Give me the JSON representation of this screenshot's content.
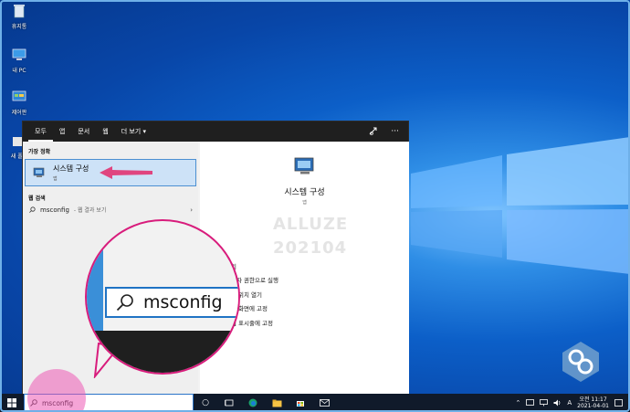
{
  "desktop": {
    "icons": [
      {
        "label": "휴지통",
        "name": "recycle-bin-icon"
      },
      {
        "label": "내 PC",
        "name": "this-pc-icon"
      },
      {
        "label": "제어판",
        "name": "control-panel-icon"
      },
      {
        "label": "새 폴더",
        "name": "new-folder-icon"
      }
    ]
  },
  "start": {
    "tabs": [
      "모두",
      "앱",
      "문서",
      "웹",
      "더 보기"
    ],
    "best_match_heading": "가장 정확",
    "best_match": {
      "title": "시스템 구성",
      "subtitle": "앱"
    },
    "web_heading": "웹 검색",
    "web_result": {
      "query": "msconfig",
      "hint": "- 웹 결과 보기"
    },
    "detail": {
      "title": "시스템 구성",
      "subtitle": "앱",
      "watermark_line1": "ALLUZE",
      "watermark_line2": "202104",
      "actions": [
        "열기",
        "관리자 권한으로 실행",
        "파일 위치 열기",
        "시작 화면에 고정",
        "작업 표시줄에 고정"
      ]
    }
  },
  "magnifier": {
    "text": "msconfig"
  },
  "taskbar": {
    "search_value": "msconfig",
    "ime": "A",
    "time": "오전 11:17",
    "date": "2021-04-01"
  },
  "colors": {
    "accent": "#0078d7",
    "highlight": "#d81c7c",
    "selection": "#cde2f7"
  }
}
